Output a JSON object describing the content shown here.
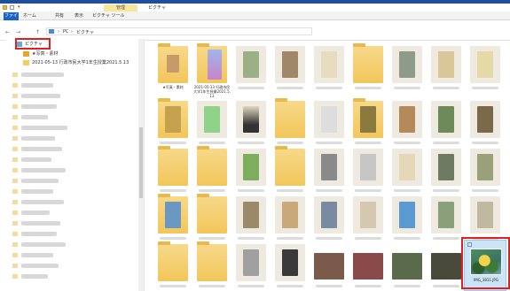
{
  "quick_access": {
    "menu_glyph": "▾"
  },
  "window": {
    "title": "",
    "manage_tab": "管理",
    "context_title": "ピクチャ"
  },
  "ribbon": {
    "tabs": [
      {
        "label": "ファイル"
      },
      {
        "label": "ホーム"
      },
      {
        "label": "共有"
      },
      {
        "label": "表示"
      },
      {
        "label": "ピクチャ ツール"
      }
    ]
  },
  "address": {
    "back": "←",
    "forward": "→",
    "up": "↑",
    "crumbs": [
      "PC",
      "ピクチャ"
    ],
    "separator": "›"
  },
  "sidebar": {
    "items": [
      {
        "label": "ピクチャ",
        "icon": "pictures-folder-icon"
      },
      {
        "label": "★写真・素材",
        "icon": "folder-icon"
      },
      {
        "label": "2021-05-13 行政市民大学1年生授業2021.5.13",
        "icon": "folder-icon"
      }
    ]
  },
  "content": {
    "folders": [
      {
        "label": "★写真・素材"
      },
      {
        "label": "2021-05-13 行政市民大学1年生授業2021.5.13"
      }
    ],
    "selected_file": {
      "label": "IMG_3811.JPG",
      "checked": "✓"
    }
  },
  "colors": {
    "accent": "#1a64c8",
    "highlight": "#e0201f",
    "selected_bg": "#cce4f7",
    "folder": "#f2c65a"
  }
}
